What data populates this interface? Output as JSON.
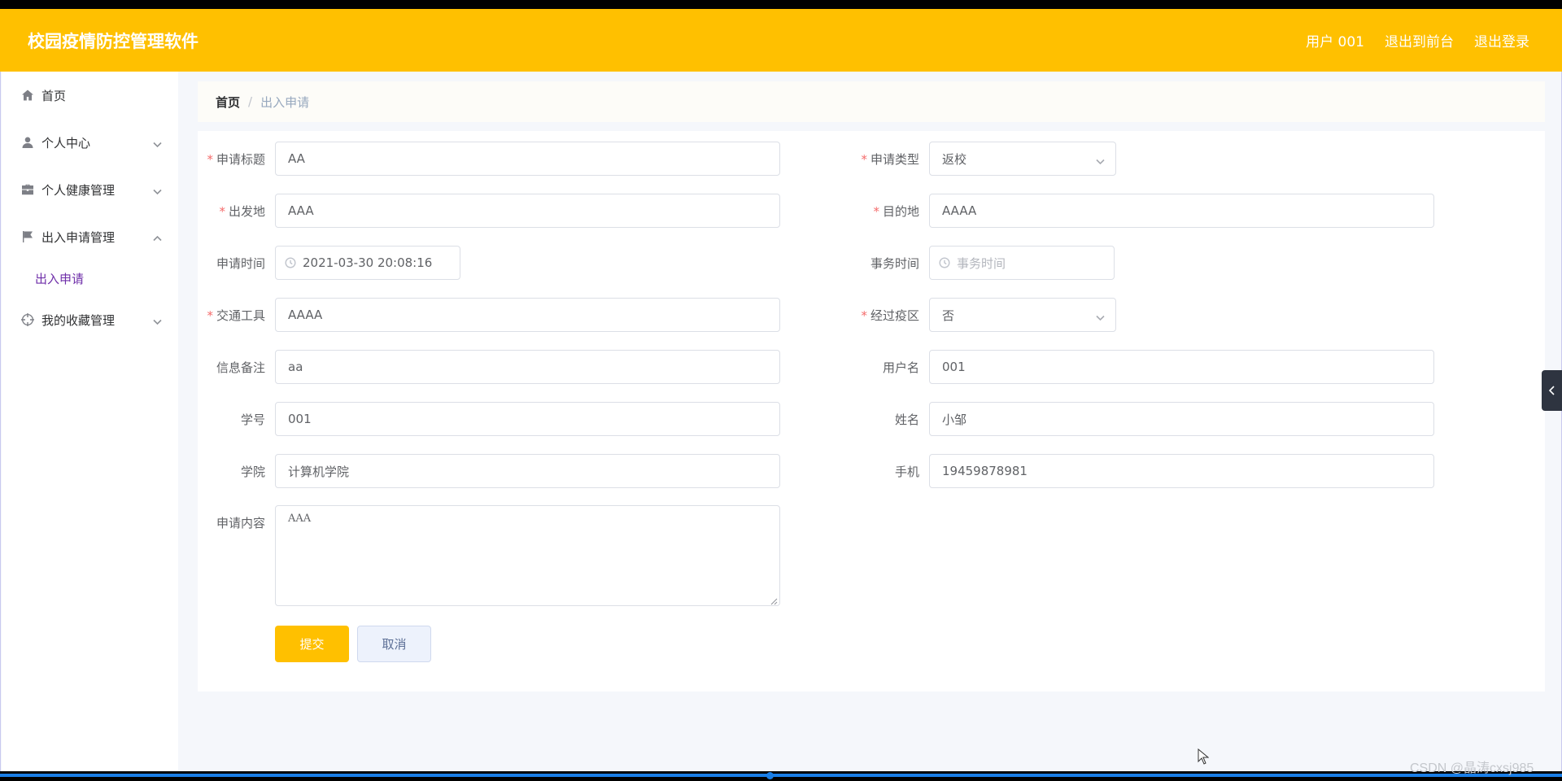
{
  "header": {
    "title": "校园疫情防控管理软件",
    "user": "用户 001",
    "exit_front": "退出到前台",
    "logout": "退出登录"
  },
  "sidebar": {
    "items": [
      {
        "label": "首页",
        "icon": "home-icon"
      },
      {
        "label": "个人中心",
        "icon": "user-icon"
      },
      {
        "label": "个人健康管理",
        "icon": "briefcase-icon"
      },
      {
        "label": "出入申请管理",
        "icon": "flag-icon"
      },
      {
        "label": "我的收藏管理",
        "icon": "target-icon"
      }
    ],
    "submenu_active": "出入申请"
  },
  "breadcrumb": {
    "home": "首页",
    "sep": "/",
    "current": "出入申请"
  },
  "form": {
    "title_label": "申请标题",
    "title_value": "AA",
    "type_label": "申请类型",
    "type_value": "返校",
    "from_label": "出发地",
    "from_value": "AAA",
    "dest_label": "目的地",
    "dest_value": "AAAA",
    "apply_time_label": "申请时间",
    "apply_time_value": "2021-03-30 20:08:16",
    "event_time_label": "事务时间",
    "event_time_placeholder": "事务时间",
    "transport_label": "交通工具",
    "transport_value": "AAAA",
    "risk_area_label": "经过疫区",
    "risk_area_value": "否",
    "note_label": "信息备注",
    "note_value": "aa",
    "username_label": "用户名",
    "username_value": "001",
    "student_id_label": "学号",
    "student_id_value": "001",
    "name_label": "姓名",
    "name_value": "小邹",
    "college_label": "学院",
    "college_value": "计算机学院",
    "phone_label": "手机",
    "phone_value": "19459878981",
    "content_label": "申请内容",
    "content_value": "AAA",
    "submit_label": "提交",
    "cancel_label": "取消",
    "required_mark": "*"
  },
  "watermark": "CSDN @晶涛cxsj985"
}
